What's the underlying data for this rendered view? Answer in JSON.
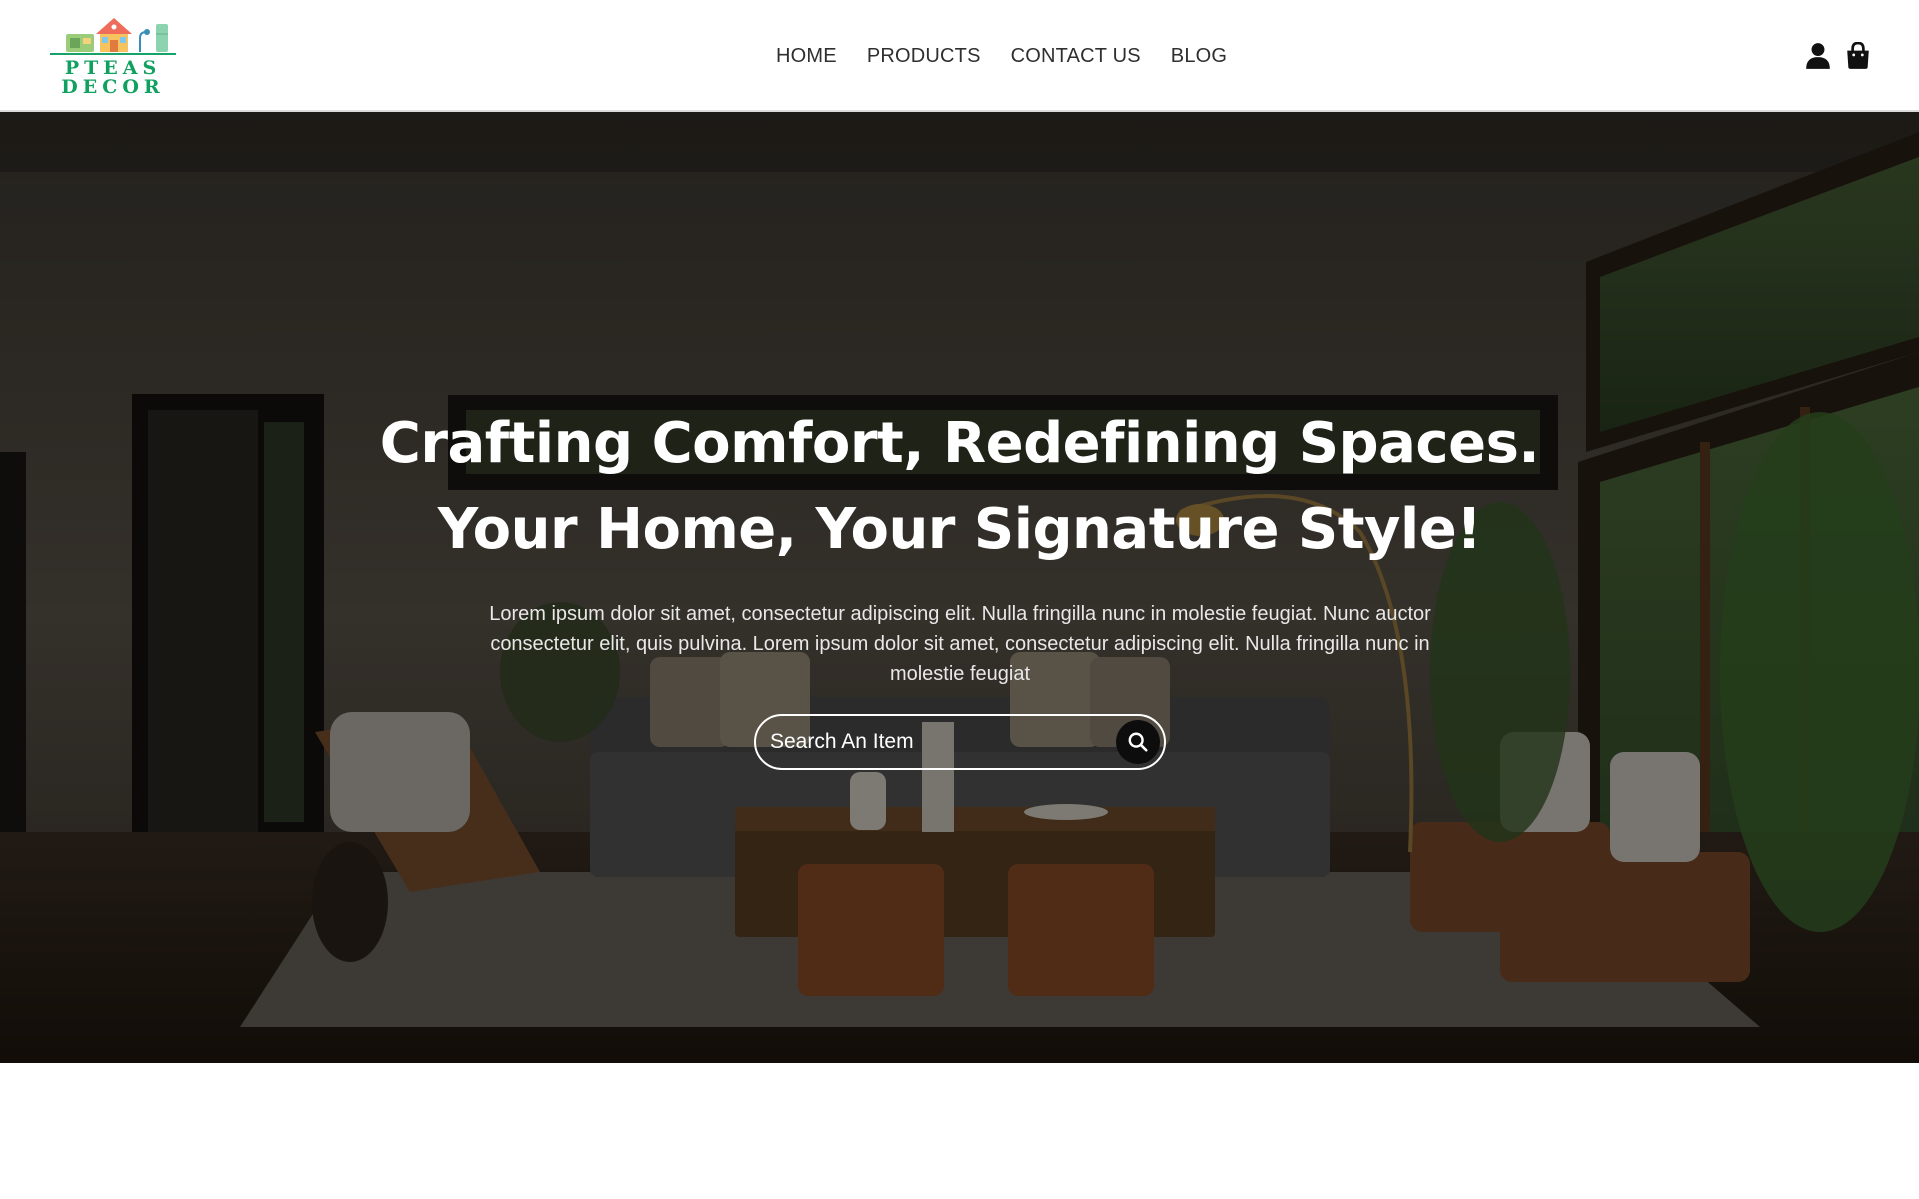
{
  "brand": {
    "name_line1": "PTEAS",
    "name_line2": "DECOR",
    "color": "#10a060"
  },
  "nav": {
    "items": [
      {
        "label": "HOME"
      },
      {
        "label": "PRODUCTS"
      },
      {
        "label": "CONTACT US"
      },
      {
        "label": "BLOG"
      }
    ]
  },
  "header_icons": {
    "account": "user-icon",
    "cart": "shopping-bag-icon"
  },
  "hero": {
    "title_line1": "Crafting Comfort, Redefining Spaces.",
    "title_line2": "Your Home, Your Signature Style!",
    "description": "Lorem ipsum dolor sit amet, consectetur adipiscing elit. Nulla fringilla nunc in molestie feugiat. Nunc auctor consectetur elit, quis pulvina. Lorem ipsum dolor sit amet, consectetur adipiscing elit. Nulla fringilla nunc in molestie feugiat",
    "search": {
      "placeholder": "Search An Item",
      "button_icon": "search-icon"
    },
    "background_image": "living room interior"
  }
}
